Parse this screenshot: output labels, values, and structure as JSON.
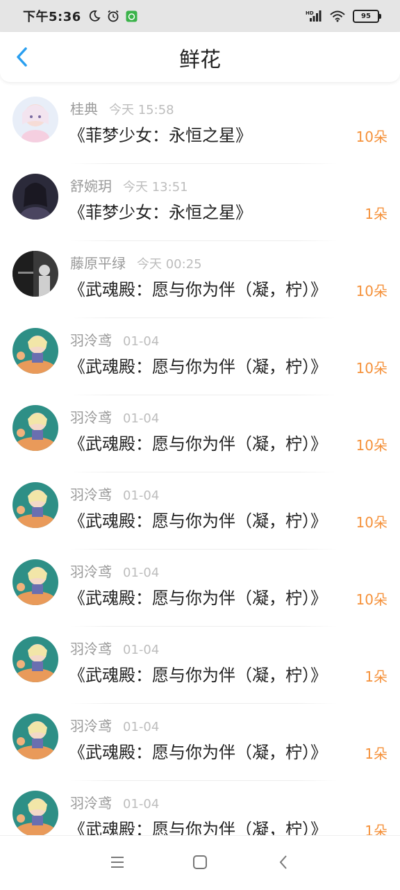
{
  "status_bar": {
    "time": "下午5:36",
    "battery": "95",
    "icons": [
      "moon-icon",
      "alarm-icon",
      "app-notification-icon",
      "hd-signal-icon",
      "wifi-icon",
      "battery-icon"
    ]
  },
  "header": {
    "title": "鲜花",
    "back_icon": "chevron-left-icon",
    "accent_color": "#2a9ff0"
  },
  "records": [
    {
      "user": "桂典",
      "time": "今天 15:58",
      "book": "《菲梦少女：永恒之星》",
      "flowers": "10朵",
      "avatar": "anime-girl-pink"
    },
    {
      "user": "舒婉玥",
      "time": "今天 13:51",
      "book": "《菲梦少女：永恒之星》",
      "flowers": "1朵",
      "avatar": "dark-portrait"
    },
    {
      "user": "藤原平绿",
      "time": "今天 00:25",
      "book": "《武魂殿：愿与你为伴（凝，柠）》",
      "flowers": "10朵",
      "avatar": "grayscale-photo"
    },
    {
      "user": "羽泠鸢",
      "time": "01-04",
      "book": "《武魂殿：愿与你为伴（凝，柠）》",
      "flowers": "10朵",
      "avatar": "anime-chibi"
    },
    {
      "user": "羽泠鸢",
      "time": "01-04",
      "book": "《武魂殿：愿与你为伴（凝，柠）》",
      "flowers": "10朵",
      "avatar": "anime-chibi"
    },
    {
      "user": "羽泠鸢",
      "time": "01-04",
      "book": "《武魂殿：愿与你为伴（凝，柠）》",
      "flowers": "10朵",
      "avatar": "anime-chibi"
    },
    {
      "user": "羽泠鸢",
      "time": "01-04",
      "book": "《武魂殿：愿与你为伴（凝，柠）》",
      "flowers": "10朵",
      "avatar": "anime-chibi"
    },
    {
      "user": "羽泠鸢",
      "time": "01-04",
      "book": "《武魂殿：愿与你为伴（凝，柠）》",
      "flowers": "1朵",
      "avatar": "anime-chibi"
    },
    {
      "user": "羽泠鸢",
      "time": "01-04",
      "book": "《武魂殿：愿与你为伴（凝，柠）》",
      "flowers": "1朵",
      "avatar": "anime-chibi"
    },
    {
      "user": "羽泠鸢",
      "time": "01-04",
      "book": "《武魂殿：愿与你为伴（凝，柠）》",
      "flowers": "1朵",
      "avatar": "anime-chibi"
    }
  ],
  "colors": {
    "flower_count": "#f5913a",
    "user_name": "#9a9a9a",
    "time": "#bdbdbd"
  },
  "nav_bar": {
    "icons": [
      "menu-icon",
      "home-square-icon",
      "back-chevron-icon"
    ]
  }
}
